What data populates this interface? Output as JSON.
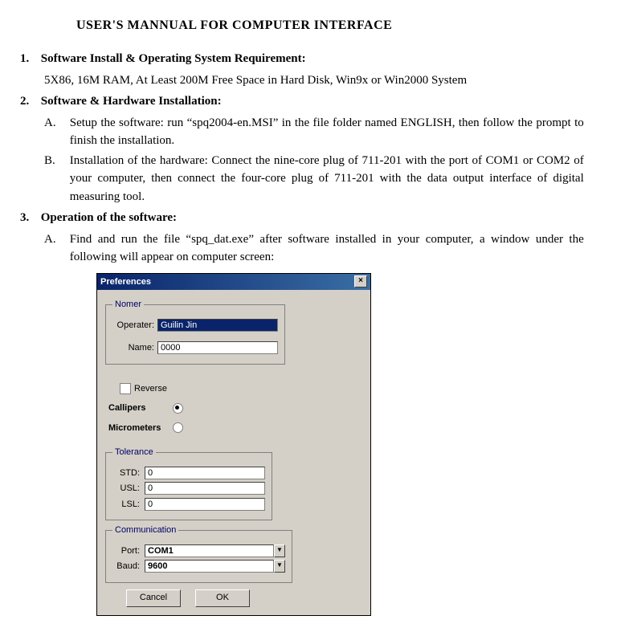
{
  "title": "USER'S MANNUAL FOR COMPUTER INTERFACE",
  "sections": {
    "s1": {
      "num": "1.",
      "heading": "Software Install & Operating System Requirement:",
      "body": "5X86, 16M RAM, At Least 200M Free Space in Hard Disk, Win9x or Win2000 System"
    },
    "s2": {
      "num": "2.",
      "heading": "Software & Hardware Installation:",
      "a": "Setup the software: run “spq2004-en.MSI” in the file folder named ENGLISH, then follow the prompt to finish the installation.",
      "b": "Installation of the hardware: Connect the nine-core plug of 711-201 with the port of COM1 or COM2 of your computer, then connect the four-core plug of 711-201 with the data output interface of digital measuring tool."
    },
    "s3": {
      "num": "3.",
      "heading": "Operation of the software:",
      "a": "Find and run the file “spq_dat.exe” after software installed in your computer, a window under the following will appear on computer screen:"
    }
  },
  "dialog": {
    "title": "Preferences",
    "nomer": {
      "legend": "Nomer",
      "operater_label": "Operater:",
      "operater_value": "Guilin Jin",
      "name_label": "Name:",
      "name_value": "0000"
    },
    "tolerance": {
      "legend": "Tolerance",
      "std_label": "STD:",
      "std_value": "0",
      "usl_label": "USL:",
      "usl_value": "0",
      "lsl_label": "LSL:",
      "lsl_value": "0"
    },
    "measure": {
      "reverse": "Reverse",
      "callipers": "Callipers",
      "micrometers": "Micrometers"
    },
    "comm": {
      "legend": "Communication",
      "port_label": "Port:",
      "port_value": "COM1",
      "baud_label": "Baud:",
      "baud_value": "9600"
    },
    "buttons": {
      "cancel": "Cancel",
      "ok": "OK"
    }
  }
}
